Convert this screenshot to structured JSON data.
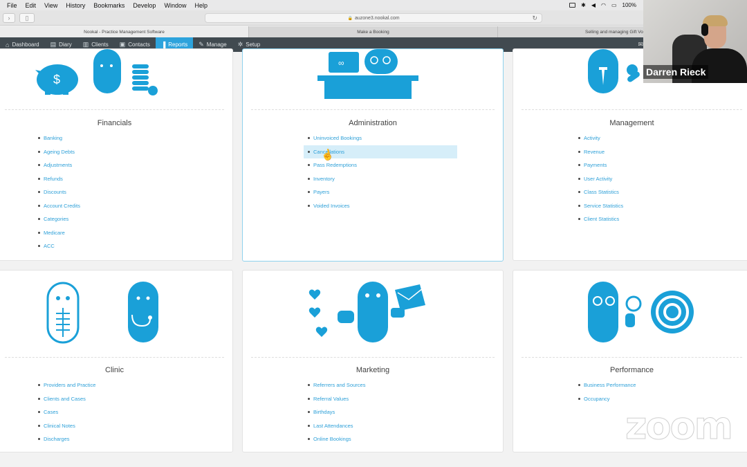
{
  "menubar": {
    "items": [
      "File",
      "Edit",
      "View",
      "History",
      "Bookmarks",
      "Develop",
      "Window",
      "Help"
    ],
    "battery": "100%"
  },
  "browser": {
    "url": "auzone3.nookal.com",
    "tabs": [
      "Nookal - Practice Management Software",
      "Make a Booking",
      "Selling and managing Gift Vouchers /"
    ]
  },
  "nav": {
    "items": [
      {
        "label": "Dashboard",
        "icon": "home-icon"
      },
      {
        "label": "Diary",
        "icon": "book-icon"
      },
      {
        "label": "Clients",
        "icon": "clients-icon"
      },
      {
        "label": "Contacts",
        "icon": "contacts-icon"
      },
      {
        "label": "Reports",
        "icon": "bar-chart-icon",
        "active": true
      },
      {
        "label": "Manage",
        "icon": "wrench-icon"
      },
      {
        "label": "Setup",
        "icon": "gear-icon"
      }
    ]
  },
  "cards": {
    "financials": {
      "title": "Financials",
      "links": [
        "Banking",
        "Ageing Debts",
        "Adjustments",
        "Refunds",
        "Discounts",
        "Account Credits",
        "Categories",
        "Medicare",
        "ACC"
      ]
    },
    "administration": {
      "title": "Administration",
      "links": [
        "Uninvoiced Bookings",
        "Cancellations",
        "Pass Redemptions",
        "Inventory",
        "Payers",
        "Voided Invoices"
      ]
    },
    "management": {
      "title": "Management",
      "links": [
        "Activity",
        "Revenue",
        "Payments",
        "User Activity",
        "Class Statistics",
        "Service Statistics",
        "Client Statistics"
      ]
    },
    "clinic": {
      "title": "Clinic",
      "links": [
        "Providers and Practice",
        "Clients and Cases",
        "Cases",
        "Clinical Notes",
        "Discharges"
      ]
    },
    "marketing": {
      "title": "Marketing",
      "links": [
        "Referrers and Sources",
        "Referral Values",
        "Birthdays",
        "Last Attendances",
        "Online Bookings"
      ]
    },
    "performance": {
      "title": "Performance",
      "links": [
        "Business Performance",
        "Occupancy"
      ]
    }
  },
  "webcam": {
    "name": "Darren Rieck"
  },
  "watermark": "zoom",
  "colors": {
    "accent": "#2da3dc",
    "illustration": "#1aa0d8",
    "nav_bg": "#414a50"
  }
}
